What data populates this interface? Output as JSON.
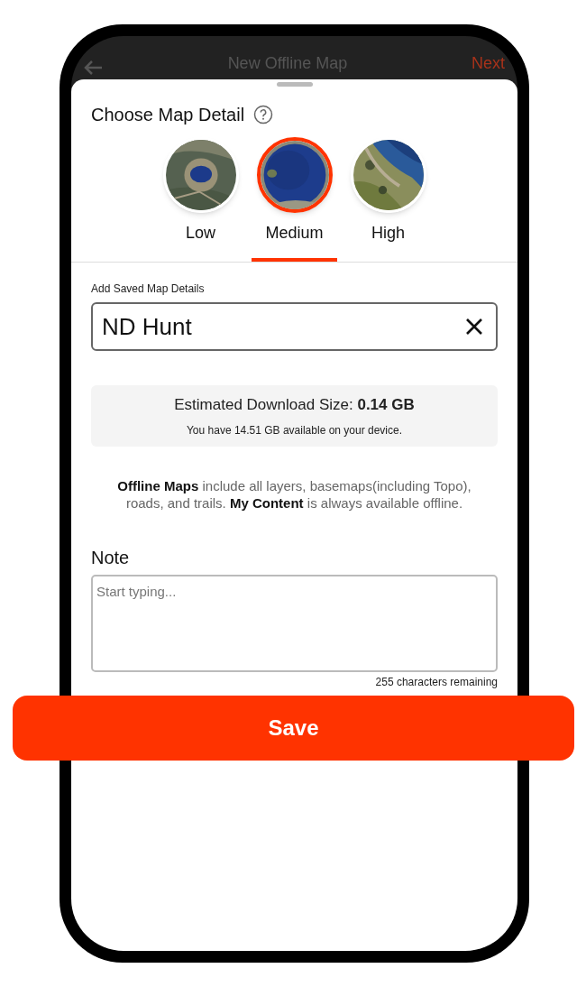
{
  "header": {
    "title": "New Offline Map",
    "action": "Next"
  },
  "sheet": {
    "title": "Choose Map Detail",
    "detail_options": [
      {
        "label": "Low",
        "selected": false
      },
      {
        "label": "Medium",
        "selected": true
      },
      {
        "label": "High",
        "selected": false
      }
    ],
    "name_field": {
      "label": "Add Saved Map Details",
      "value": "ND Hunt"
    },
    "estimate": {
      "size": "Estimated Download Size: **0.14 GB**",
      "available": "You have 14.51 GB available on your device."
    },
    "info": "**Offline Maps** include all layers, basemaps(including Topo), roads, and trails. **My Content** is always available offline.",
    "note": {
      "label": "Note",
      "placeholder": "Start typing...",
      "counter": "255 characters remaining"
    }
  },
  "save_button": "Save"
}
